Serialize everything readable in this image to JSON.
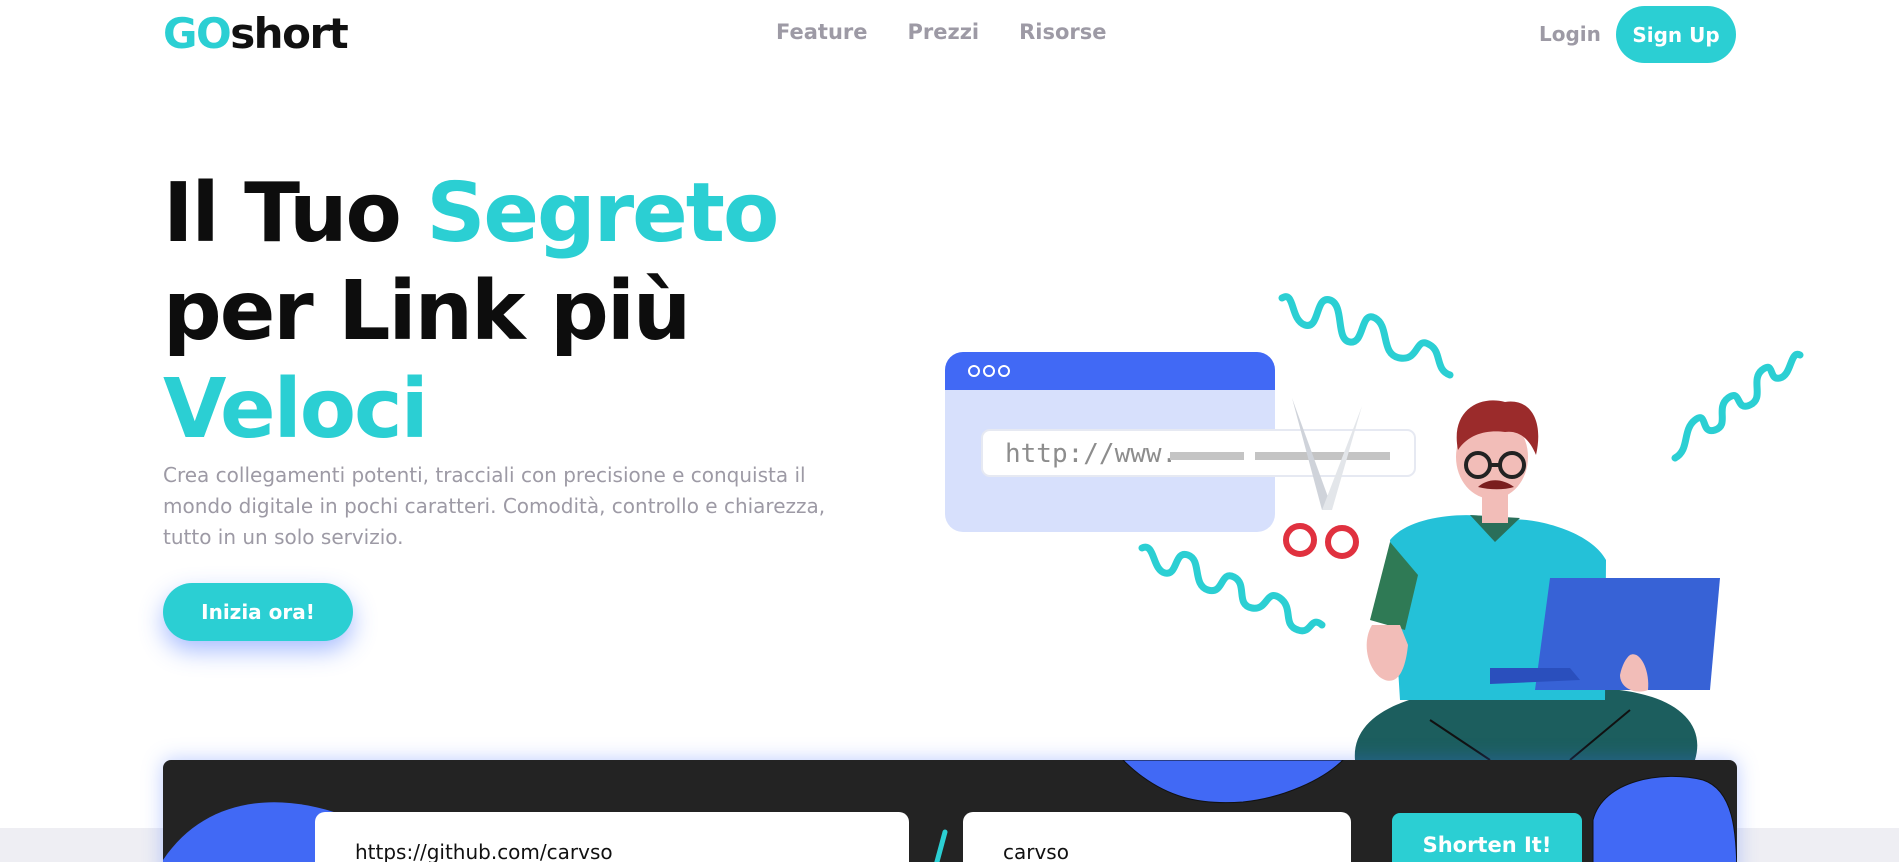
{
  "brand": {
    "logo_part1": "GO",
    "logo_part2": "short"
  },
  "nav": {
    "links": [
      "Feature",
      "Prezzi",
      "Risorse"
    ],
    "login_label": "Login",
    "signup_label": "Sign Up"
  },
  "hero": {
    "title_line1_a": "Il Tuo ",
    "title_line1_b": "Segreto",
    "title_line2": "per Link più",
    "title_line3": "Veloci",
    "description": "Crea collegamenti potenti, tracciali con precisione e conquista il mondo digitale in pochi caratteri. Comodità, controllo e chiarezza, tutto in un solo servizio.",
    "cta_label": "Inizia ora!"
  },
  "illustration": {
    "browser_url": "http://www."
  },
  "shortener": {
    "url_value": "https://github.com/carvso",
    "alias_value": "carvso",
    "button_label": "Shorten It!"
  },
  "colors": {
    "accent": "#2bcfd3",
    "blue": "#3f6cf6",
    "panel": "#232323",
    "muted_text": "#9d9aa5"
  }
}
